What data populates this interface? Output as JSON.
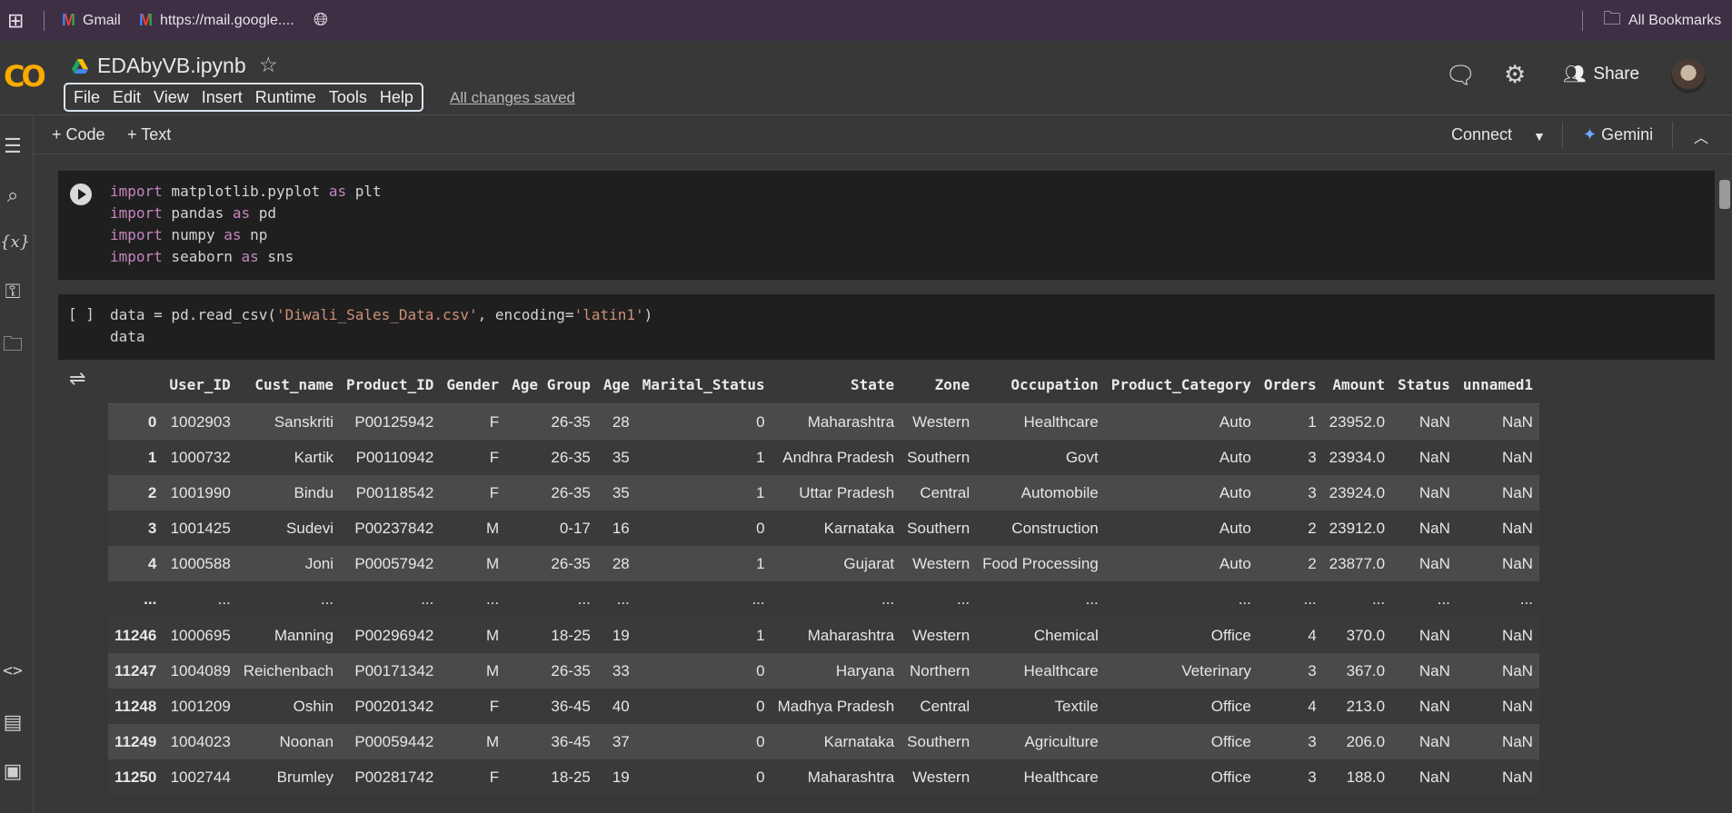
{
  "bookmarks": {
    "apps_icon": "grid-icon",
    "items": [
      {
        "label": "Gmail",
        "icon": "gmail-icon"
      },
      {
        "label": "https://mail.google....",
        "icon": "gmail-icon"
      },
      {
        "label": "",
        "icon": "globe-icon"
      }
    ],
    "all_bookmarks": "All Bookmarks"
  },
  "header": {
    "logo": "CO",
    "file_title": "EDAbyVB.ipynb",
    "menu": [
      "File",
      "Edit",
      "View",
      "Insert",
      "Runtime",
      "Tools",
      "Help"
    ],
    "save_status": "All changes saved",
    "share_label": "Share"
  },
  "toolbar": {
    "add_code": "Code",
    "add_text": "Text",
    "connect": "Connect",
    "gemini": "Gemini"
  },
  "cells": [
    {
      "lines": [
        [
          "import",
          " matplotlib.pyplot ",
          "as",
          " plt"
        ],
        [
          "import",
          " pandas ",
          "as",
          " pd"
        ],
        [
          "import",
          " numpy ",
          "as",
          " np"
        ],
        [
          "import",
          " seaborn ",
          "as",
          " sns"
        ]
      ]
    },
    {
      "exec_count": "[ ]",
      "line1_pre": "data = pd.read_csv(",
      "line1_str": "'Diwali_Sales_Data.csv'",
      "line1_mid": ", encoding=",
      "line1_str2": "'latin1'",
      "line1_post": ")",
      "line2": "data"
    }
  ],
  "dataframe": {
    "columns": [
      "",
      "User_ID",
      "Cust_name",
      "Product_ID",
      "Gender",
      "Age Group",
      "Age",
      "Marital_Status",
      "State",
      "Zone",
      "Occupation",
      "Product_Category",
      "Orders",
      "Amount",
      "Status",
      "unnamed1"
    ],
    "rows": [
      [
        "0",
        "1002903",
        "Sanskriti",
        "P00125942",
        "F",
        "26-35",
        "28",
        "0",
        "Maharashtra",
        "Western",
        "Healthcare",
        "Auto",
        "1",
        "23952.0",
        "NaN",
        "NaN"
      ],
      [
        "1",
        "1000732",
        "Kartik",
        "P00110942",
        "F",
        "26-35",
        "35",
        "1",
        "Andhra Pradesh",
        "Southern",
        "Govt",
        "Auto",
        "3",
        "23934.0",
        "NaN",
        "NaN"
      ],
      [
        "2",
        "1001990",
        "Bindu",
        "P00118542",
        "F",
        "26-35",
        "35",
        "1",
        "Uttar Pradesh",
        "Central",
        "Automobile",
        "Auto",
        "3",
        "23924.0",
        "NaN",
        "NaN"
      ],
      [
        "3",
        "1001425",
        "Sudevi",
        "P00237842",
        "M",
        "0-17",
        "16",
        "0",
        "Karnataka",
        "Southern",
        "Construction",
        "Auto",
        "2",
        "23912.0",
        "NaN",
        "NaN"
      ],
      [
        "4",
        "1000588",
        "Joni",
        "P00057942",
        "M",
        "26-35",
        "28",
        "1",
        "Gujarat",
        "Western",
        "Food Processing",
        "Auto",
        "2",
        "23877.0",
        "NaN",
        "NaN"
      ],
      [
        "...",
        "...",
        "...",
        "...",
        "...",
        "...",
        "...",
        "...",
        "...",
        "...",
        "...",
        "...",
        "...",
        "...",
        "...",
        "..."
      ],
      [
        "11246",
        "1000695",
        "Manning",
        "P00296942",
        "M",
        "18-25",
        "19",
        "1",
        "Maharashtra",
        "Western",
        "Chemical",
        "Office",
        "4",
        "370.0",
        "NaN",
        "NaN"
      ],
      [
        "11247",
        "1004089",
        "Reichenbach",
        "P00171342",
        "M",
        "26-35",
        "33",
        "0",
        "Haryana",
        "Northern",
        "Healthcare",
        "Veterinary",
        "3",
        "367.0",
        "NaN",
        "NaN"
      ],
      [
        "11248",
        "1001209",
        "Oshin",
        "P00201342",
        "F",
        "36-45",
        "40",
        "0",
        "Madhya Pradesh",
        "Central",
        "Textile",
        "Office",
        "4",
        "213.0",
        "NaN",
        "NaN"
      ],
      [
        "11249",
        "1004023",
        "Noonan",
        "P00059442",
        "M",
        "36-45",
        "37",
        "0",
        "Karnataka",
        "Southern",
        "Agriculture",
        "Office",
        "3",
        "206.0",
        "NaN",
        "NaN"
      ],
      [
        "11250",
        "1002744",
        "Brumley",
        "P00281742",
        "F",
        "18-25",
        "19",
        "0",
        "Maharashtra",
        "Western",
        "Healthcare",
        "Office",
        "3",
        "188.0",
        "NaN",
        "NaN"
      ]
    ]
  }
}
